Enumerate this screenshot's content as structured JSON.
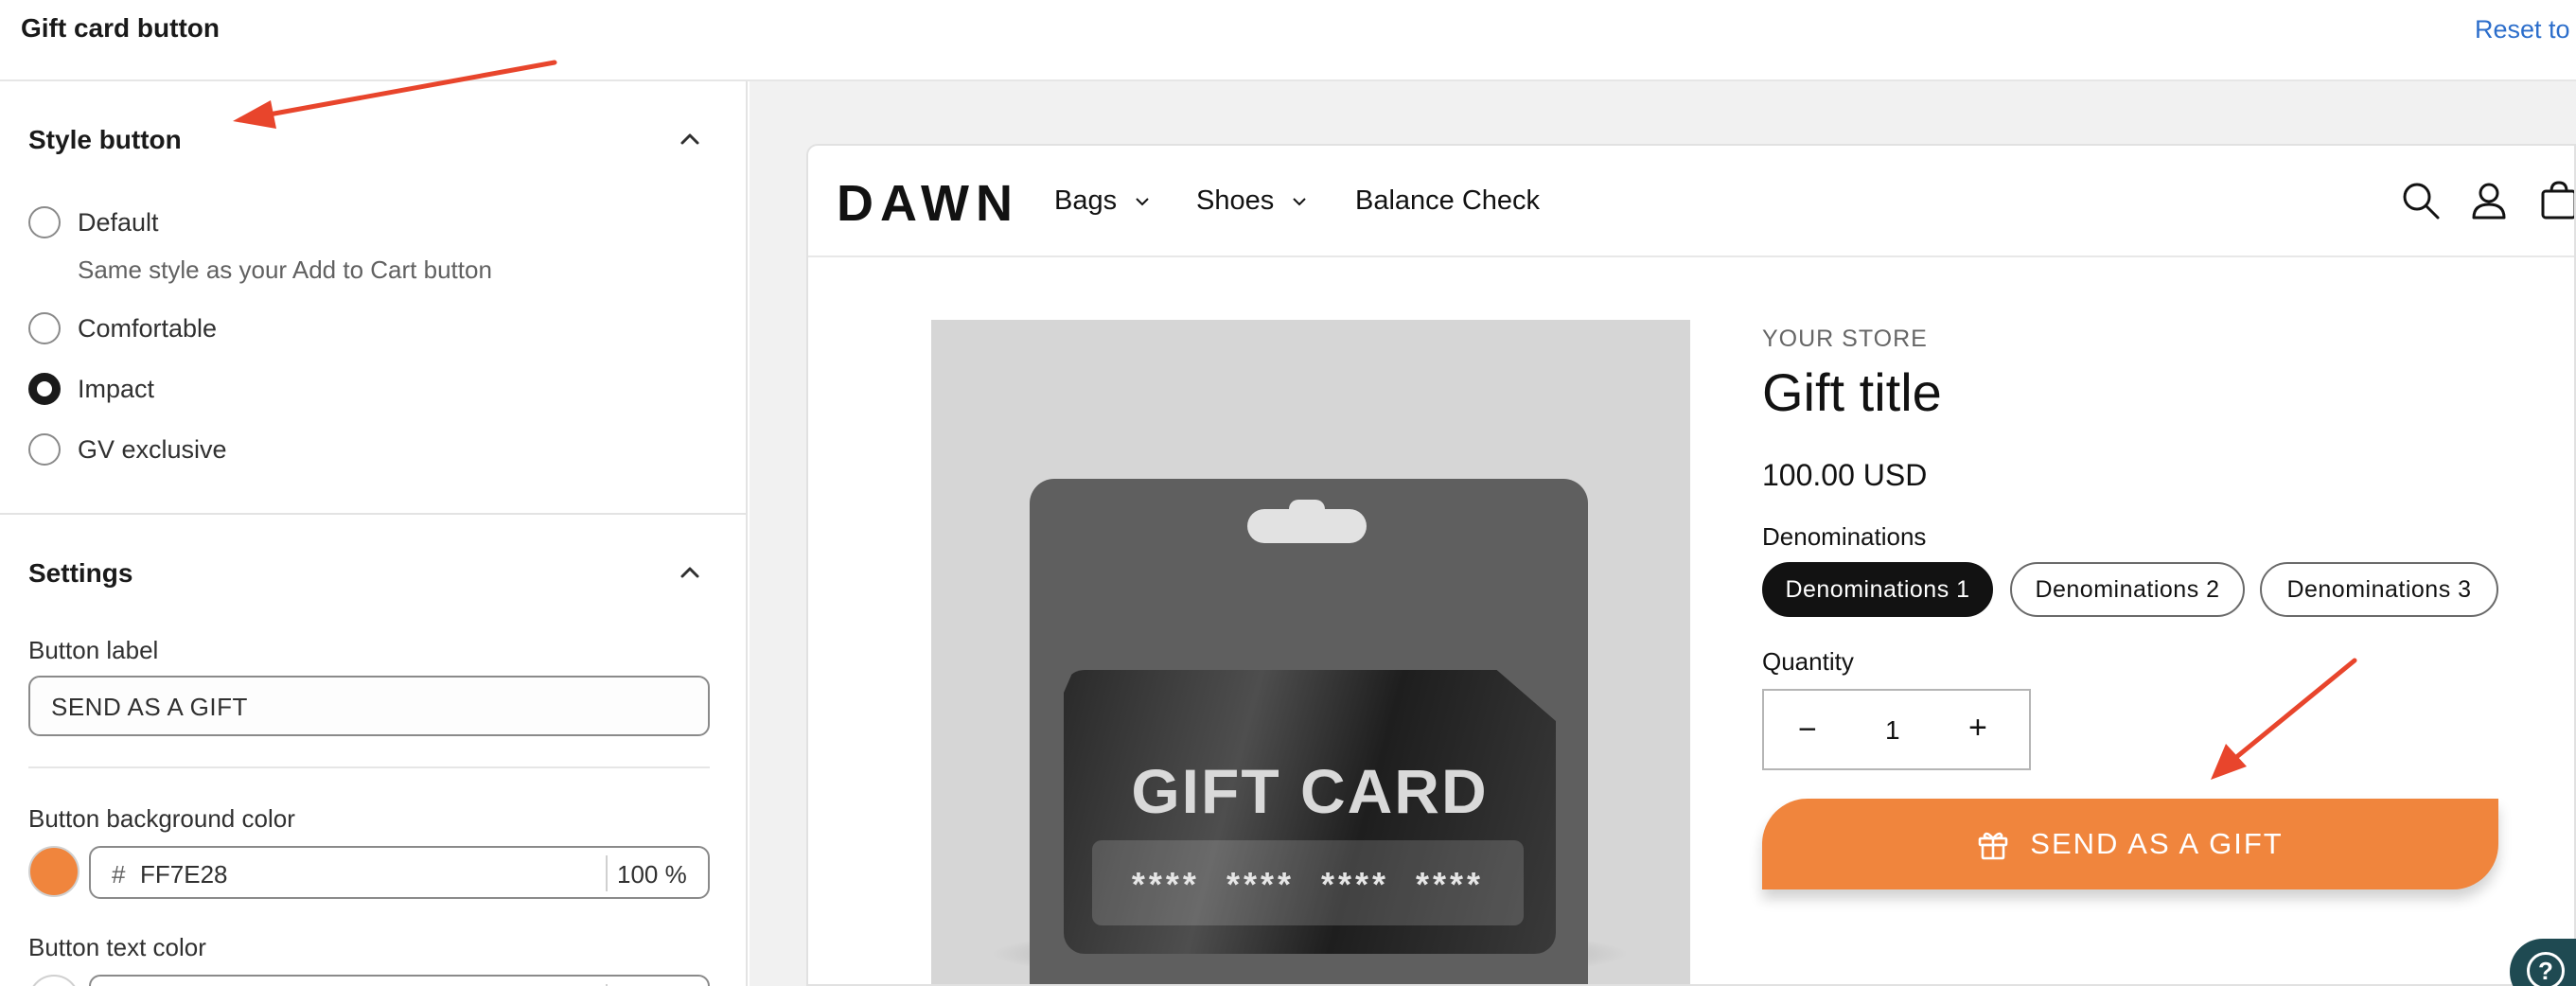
{
  "topbar": {
    "title": "Gift card button",
    "reset": "Reset to"
  },
  "style_section": {
    "title": "Style button",
    "options": [
      {
        "label": "Default",
        "help": "Same style as your Add to Cart button",
        "checked": false
      },
      {
        "label": "Comfortable",
        "checked": false
      },
      {
        "label": "Impact",
        "checked": true
      },
      {
        "label": "GV exclusive",
        "checked": false
      }
    ]
  },
  "settings_section": {
    "title": "Settings",
    "button_label": {
      "label": "Button label",
      "value": "SEND AS A GIFT"
    },
    "bg_color": {
      "label": "Button background color",
      "hash": "#",
      "hex": "FF7E28",
      "opacity": "100 %",
      "swatch": "#f0853d"
    },
    "text_color": {
      "label": "Button text color"
    }
  },
  "preview": {
    "logo": "DAWN",
    "nav": [
      "Bags",
      "Shoes",
      "Balance Check"
    ],
    "image": {
      "title": "GIFT CARD",
      "number": "**** **** **** ****"
    },
    "vendor": "YOUR STORE",
    "title": "Gift title",
    "price": "100.00 USD",
    "denominations_label": "Denominations",
    "denominations": [
      "Denominations 1",
      "Denominations 2",
      "Denominations 3"
    ],
    "quantity_label": "Quantity",
    "quantity": {
      "minus": "−",
      "value": "1",
      "plus": "+"
    },
    "gift_button": {
      "label": "SEND AS A GIFT",
      "color": "#f0853d"
    }
  },
  "help": {
    "icon": "?"
  }
}
